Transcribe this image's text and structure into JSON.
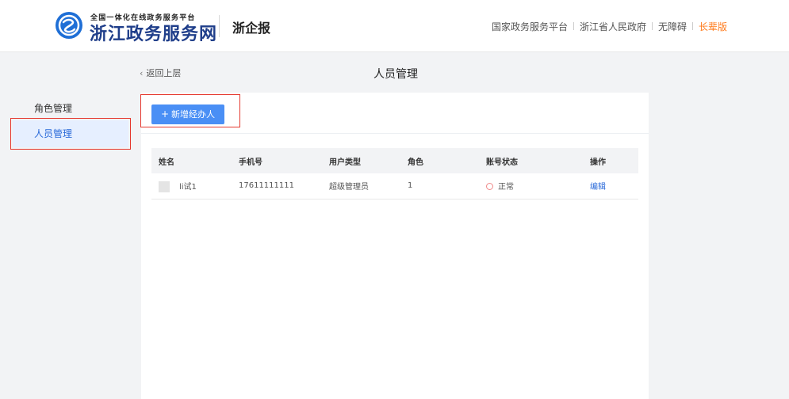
{
  "header": {
    "logo_small": "全国一体化在线政务服务平台",
    "logo_big": "浙江政务服务网",
    "logo_sub": "浙企报",
    "nav": [
      {
        "label": "国家政务服务平台"
      },
      {
        "label": "浙江省人民政府"
      },
      {
        "label": "无障碍"
      },
      {
        "label": "长辈版",
        "color": "#ff7a1a"
      }
    ]
  },
  "back_label": "返回上层",
  "back_icon": "chevron-left-icon",
  "page_title": "人员管理",
  "sidebar": {
    "items": [
      {
        "label": "角色管理",
        "active": false
      },
      {
        "label": "人员管理",
        "active": true
      }
    ]
  },
  "toolbar": {
    "add_label": "新增经办人",
    "add_icon": "plus-icon"
  },
  "table": {
    "headers": [
      "姓名",
      "手机号",
      "用户类型",
      "角色",
      "账号状态",
      "操作"
    ],
    "rows": [
      {
        "name": "li试1",
        "phone": "17611111111",
        "user_type": "超级管理员",
        "role": "1",
        "status": "正常",
        "action": "编辑"
      }
    ]
  },
  "colors": {
    "accent": "#4a8ff5",
    "link": "#2a6ad9",
    "highlight": "#ff7a1a",
    "frame": "#e5382e",
    "status": "#f08a8a"
  }
}
